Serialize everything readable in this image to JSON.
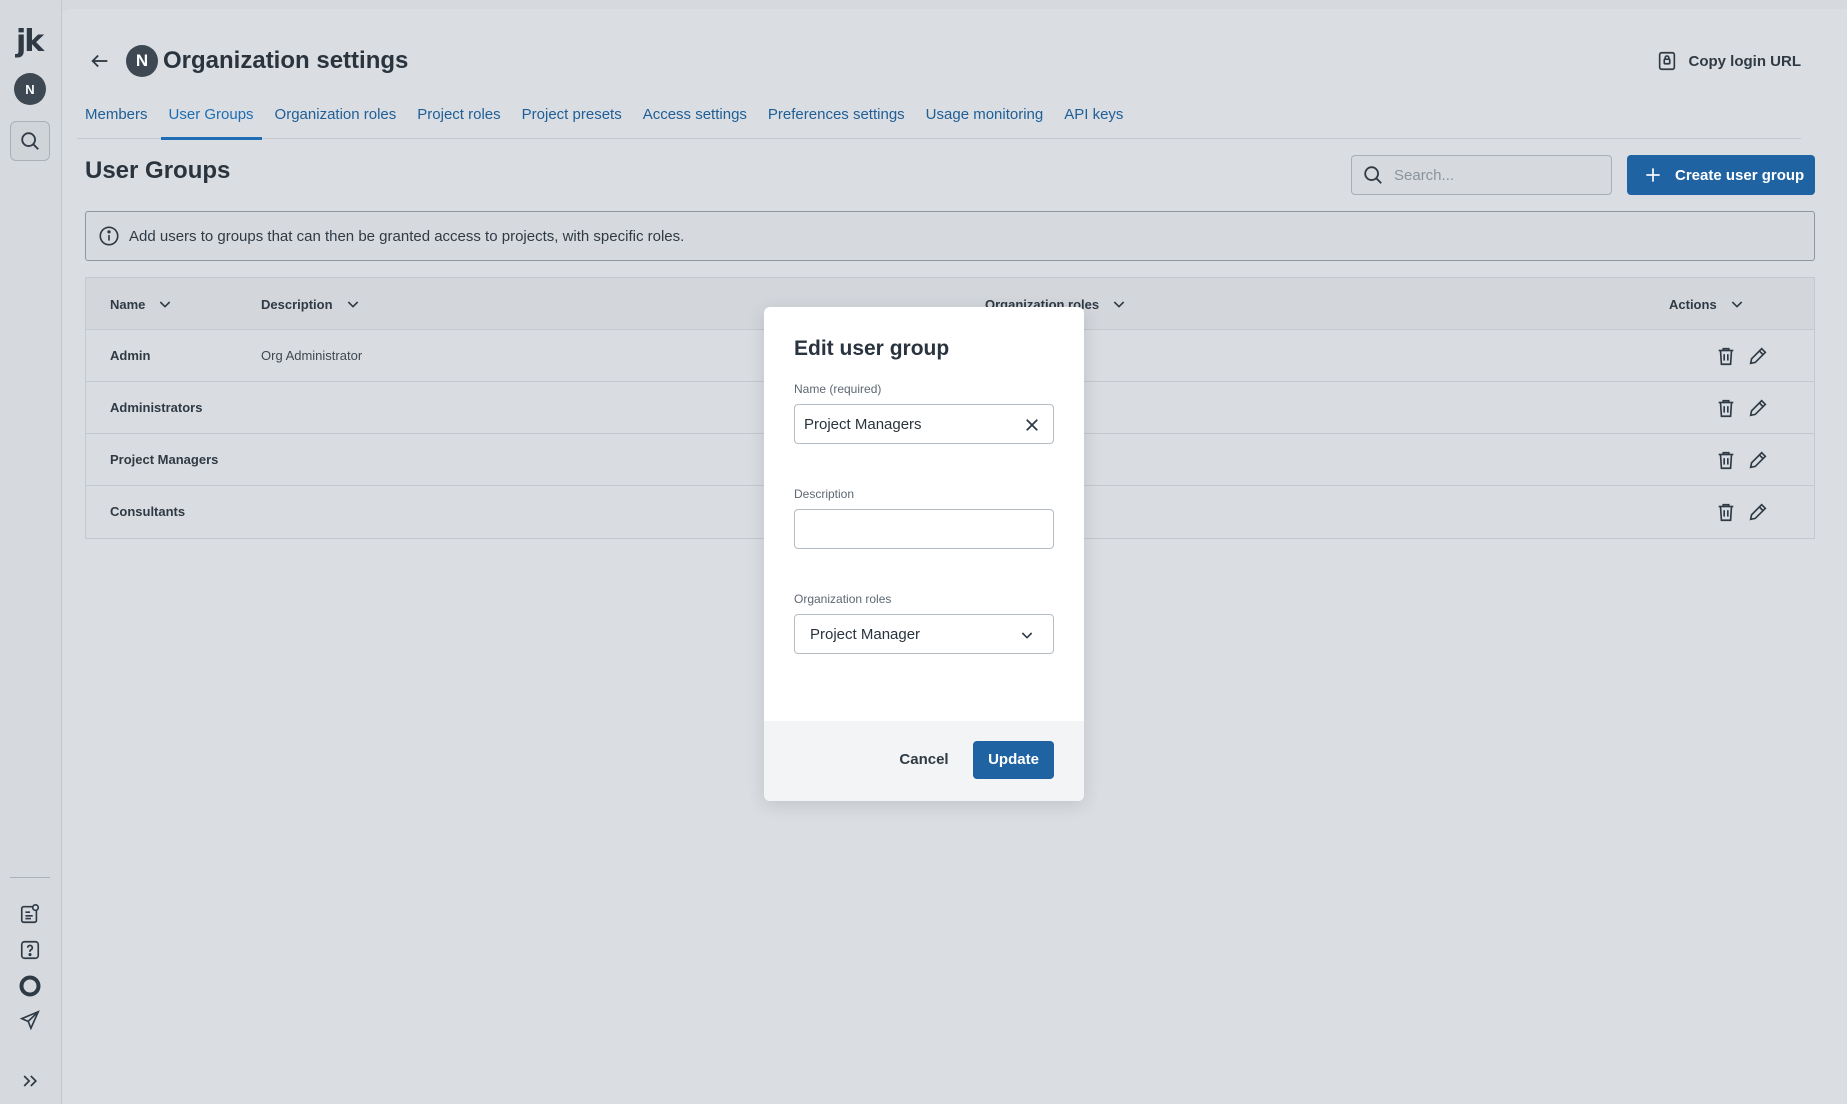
{
  "sidebar": {
    "logo": "jk",
    "avatar_initial": "N",
    "icons": [
      "search-icon",
      "changelog-icon",
      "help-icon",
      "status-circle-icon",
      "send-icon",
      "expand-icon"
    ]
  },
  "header": {
    "org_initial": "N",
    "title": "Organization settings",
    "copy_login_url": "Copy login URL"
  },
  "tabs": [
    {
      "label": "Members",
      "active": false
    },
    {
      "label": "User Groups",
      "active": true
    },
    {
      "label": "Organization roles",
      "active": false
    },
    {
      "label": "Project roles",
      "active": false
    },
    {
      "label": "Project presets",
      "active": false
    },
    {
      "label": "Access settings",
      "active": false
    },
    {
      "label": "Preferences settings",
      "active": false
    },
    {
      "label": "Usage monitoring",
      "active": false
    },
    {
      "label": "API keys",
      "active": false
    }
  ],
  "section": {
    "title": "User Groups",
    "search_placeholder": "Search...",
    "create_button": "Create user group",
    "info_text": "Add users to groups that can then be granted access to projects, with specific roles."
  },
  "table": {
    "columns": {
      "name": "Name",
      "description": "Description",
      "org_roles": "Organization roles",
      "actions": "Actions"
    },
    "rows": [
      {
        "name": "Admin",
        "description": "Org Administrator"
      },
      {
        "name": "Administrators",
        "description": ""
      },
      {
        "name": "Project Managers",
        "description": ""
      },
      {
        "name": "Consultants",
        "description": ""
      }
    ]
  },
  "modal": {
    "title": "Edit user group",
    "name_label": "Name (required)",
    "name_value": "Project Managers",
    "description_label": "Description",
    "description_value": "",
    "roles_label": "Organization roles",
    "roles_value": "Project Manager",
    "cancel": "Cancel",
    "update": "Update"
  },
  "colors": {
    "primary": "#1f63a3",
    "tab_active": "#1f6db3",
    "backdrop": "#d6dade"
  }
}
